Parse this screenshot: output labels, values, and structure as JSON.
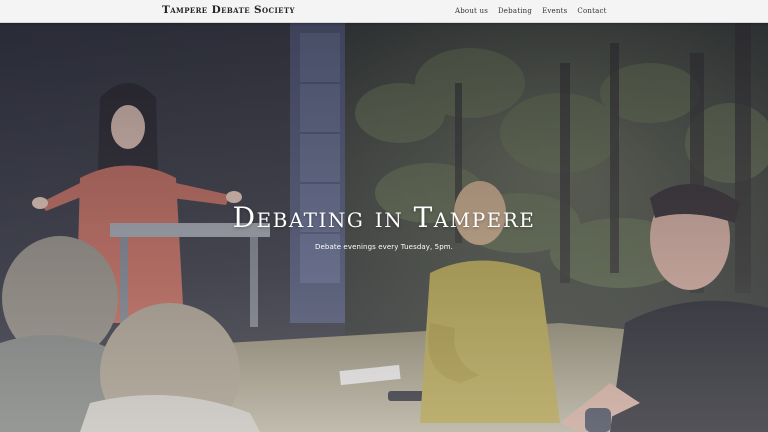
{
  "navbar": {
    "brand": "Tampere Debate Society",
    "links": [
      {
        "label": "About us"
      },
      {
        "label": "Debating"
      },
      {
        "label": "Events"
      },
      {
        "label": "Contact"
      }
    ]
  },
  "hero": {
    "title": "Debating in Tampere",
    "subtitle": "Debate evenings every Tuesday, 5pm."
  },
  "colors": {
    "navbar_bg": "#f4f4f4",
    "hero_text": "#ffffff"
  }
}
